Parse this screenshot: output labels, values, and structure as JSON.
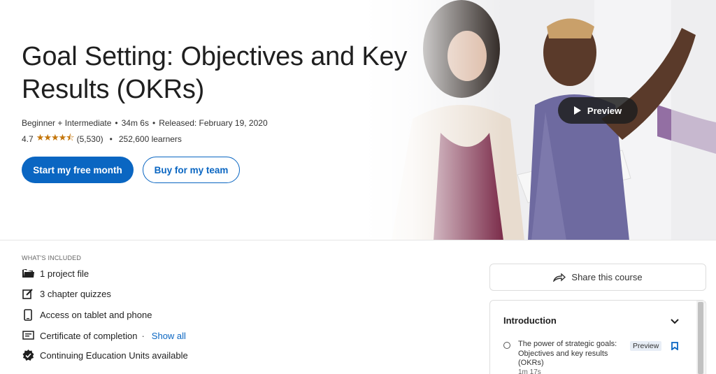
{
  "course": {
    "title": "Goal Setting: Objectives and Key Results (OKRs)",
    "level": "Beginner + Intermediate",
    "duration": "34m 6s",
    "released": "Released: February 19, 2020",
    "rating": "4.7",
    "rating_count": "(5,530)",
    "learners": "252,600 learners"
  },
  "buttons": {
    "start_free": "Start my free month",
    "buy_team": "Buy for my team",
    "preview": "Preview",
    "share": "Share this course"
  },
  "included": {
    "label": "WHAT'S INCLUDED",
    "items": [
      {
        "icon": "folder-icon",
        "text": "1 project file"
      },
      {
        "icon": "quiz-icon",
        "text": "3 chapter quizzes"
      },
      {
        "icon": "phone-icon",
        "text": "Access on tablet and phone"
      },
      {
        "icon": "certificate-icon",
        "text": "Certificate of completion"
      },
      {
        "icon": "badge-icon",
        "text": "Continuing Education Units available"
      }
    ],
    "show_all": "Show all"
  },
  "toc": {
    "section": "Introduction",
    "lessons": [
      {
        "title": "The power of strategic goals: Objectives and key results (OKRs)",
        "time": "1m 17s",
        "badge": "Preview"
      }
    ]
  },
  "colors": {
    "accent": "#0a66c2",
    "star": "#c4760b"
  }
}
